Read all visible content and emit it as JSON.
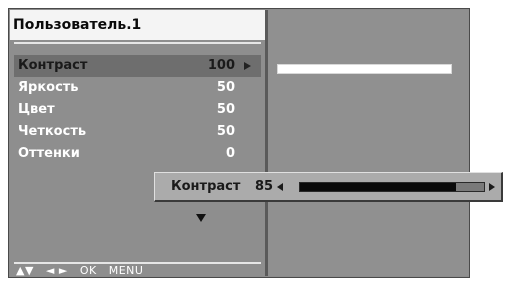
{
  "menu": {
    "title": "Пользователь.1",
    "items": [
      {
        "label": "Контраст",
        "value": "100",
        "selected": true
      },
      {
        "label": "Яркость",
        "value": "50",
        "selected": false
      },
      {
        "label": "Цвет",
        "value": "50",
        "selected": false
      },
      {
        "label": "Четкость",
        "value": "50",
        "selected": false
      },
      {
        "label": "Оттенки",
        "value": "0",
        "selected": false
      }
    ]
  },
  "slider": {
    "label": "Контраст",
    "value": "85",
    "level": 0.85
  },
  "hints": {
    "updown": "▲▼",
    "leftright": "◄ ►",
    "ok": "OK",
    "menu": "MENU"
  },
  "colors": {
    "panel": "#8e8e8e",
    "title_bg": "#f4f4f4",
    "selected_bg": "#6e6e6e",
    "slider_fill": "#0a0a0a"
  },
  "icons": [
    "right-arrow-icon",
    "left-arrow-icon",
    "down-arrow-icon"
  ]
}
